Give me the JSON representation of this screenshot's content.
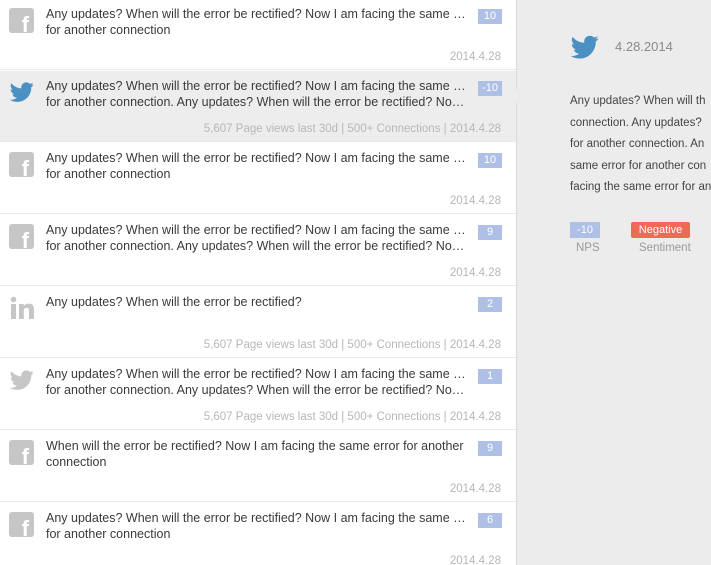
{
  "feed": {
    "items": [
      {
        "network": "facebook",
        "icon": "facebook-icon",
        "lines": [
          "Any updates? When will the error be rectified? Now I am facing the same error",
          "for another connection"
        ],
        "score": "10",
        "meta": "2014.4.28",
        "selected": false
      },
      {
        "network": "twitter",
        "icon": "twitter-icon",
        "lines": [
          "Any updates? When will the error be rectified? Now I am facing the same error",
          "for another connection. Any updates? When will the error be rectified? Now I..."
        ],
        "score": "-10",
        "meta": "5,607 Page views last 30d | 500+ Connections | 2014.4.28",
        "selected": true
      },
      {
        "network": "facebook",
        "icon": "facebook-icon",
        "lines": [
          "Any updates? When will the error be rectified? Now I am facing the same error",
          "for another connection"
        ],
        "score": "10",
        "meta": "2014.4.28",
        "selected": false
      },
      {
        "network": "facebook",
        "icon": "facebook-icon",
        "lines": [
          "Any updates? When will the error be rectified? Now I am facing the same error",
          "for another connection. Any updates? When will the error be rectified? Now I..."
        ],
        "score": "9",
        "meta": "2014.4.28",
        "selected": false
      },
      {
        "network": "linkedin",
        "icon": "linkedin-icon",
        "lines": [
          "Any updates? When will the error be rectified?"
        ],
        "score": "2",
        "meta": "5,607 Page views last 30d | 500+ Connections | 2014.4.28",
        "selected": false
      },
      {
        "network": "twitter",
        "icon": "twitter-icon",
        "lines": [
          "Any updates? When will the error be rectified? Now I am facing the same error",
          "for another connection. Any updates? When will the error be rectified? Now I..."
        ],
        "score": "1",
        "meta": "5,607 Page views last 30d | 500+ Connections | 2014.4.28",
        "selected": false
      },
      {
        "network": "facebook",
        "icon": "facebook-icon",
        "lines": [
          "When will the error be rectified? Now I am facing the same error for another",
          "connection"
        ],
        "score": "9",
        "meta": "2014.4.28",
        "selected": false
      },
      {
        "network": "facebook",
        "icon": "facebook-icon",
        "lines": [
          "Any updates? When will the error be rectified? Now I am facing the same error",
          "for another connection"
        ],
        "score": "6",
        "meta": "2014.4.28",
        "selected": false
      }
    ]
  },
  "detail": {
    "icon": "twitter-icon",
    "date": "4.28.2014",
    "lines": [
      "Any updates? When will th",
      "connection. Any updates?",
      "for another connection. An",
      "same error for another con",
      "facing the same error for an"
    ],
    "nps_value": "-10",
    "nps_label": "NPS",
    "sentiment_value": "Negative",
    "sentiment_label": "Sentiment"
  },
  "colors": {
    "score_badge": "#aec0e6",
    "twitter_blue": "#4a90c2",
    "icon_gray": "#c6c6c6",
    "negative": "#ef6a56",
    "selected_row": "#ededed",
    "detail_bg": "#ececec"
  }
}
